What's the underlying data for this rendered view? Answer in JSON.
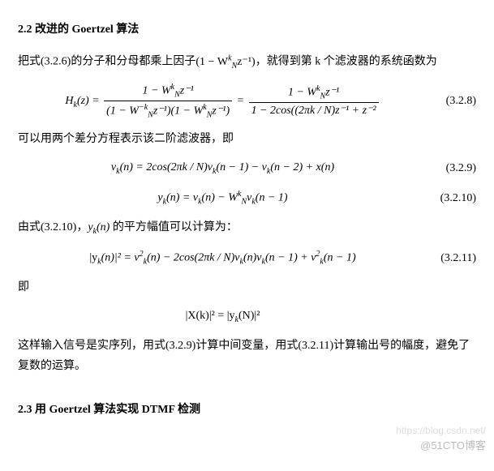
{
  "section22": {
    "heading": "2.2 改进的 Goertzel  算法",
    "p1_a": "把式(3.2.6)的分子和分母都乘上因子",
    "p1_factor": "(1 − W",
    "p1_factor_sub": "N",
    "p1_factor_sup": "k",
    "p1_factor_end": "z⁻¹)",
    "p1_b": "，就得到第 k 个滤波器的系统函数为",
    "eq328": {
      "lhs": "H",
      "lhs_sub": "k",
      "lhs_arg": "(z) = ",
      "num1": "1 − W",
      "num1_sub": "N",
      "num1_sup": "k",
      "num1_end": "z⁻¹",
      "den1a": "(1 − W",
      "den1a_sub": "N",
      "den1a_sup": "−k",
      "den1a_end": "z⁻¹)(1 − W",
      "den1b_sub": "N",
      "den1b_sup": "k",
      "den1b_end": "z⁻¹)",
      "eq": " = ",
      "num2": "1 − W",
      "num2_sub": "N",
      "num2_sup": "k",
      "num2_end": "z⁻¹",
      "den2": "1 − 2cos((2πk / N)z⁻¹ + z⁻²",
      "num": "(3.2.8)"
    },
    "p2": "可以用两个差分方程表示该二阶滤波器，即",
    "eq329": {
      "text": "v",
      "sub1": "k",
      "body": "(n) = 2cos(2πk / N)v",
      "sub2": "k",
      "body2": "(n − 1) − v",
      "sub3": "k",
      "body3": "(n − 2) + x(n)",
      "num": "(3.2.9)"
    },
    "eq3210": {
      "text": "y",
      "sub1": "k",
      "body": "(n) = v",
      "sub2": "k",
      "body2": "(n) − W",
      "supN": "k",
      "subN": "N",
      "body3": "v",
      "sub3": "k",
      "body4": "(n − 1)",
      "num": "(3.2.10)"
    },
    "p3a": "由式(3.2.10)，",
    "p3y": "y",
    "p3y_sub": "k",
    "p3y_arg": "(n)",
    "p3b": " 的平方幅值可以计算为：",
    "eq3211": {
      "lhs": "|y",
      "lhs_sub": "k",
      "lhs2": "(n)|² = v",
      "sub1": "k",
      "sup1": "2",
      "body1": "(n) − 2cos(2πk / N)v",
      "sub2": "k",
      "body2": "(n)v",
      "sub3": "k",
      "body3": "(n − 1) + v",
      "sub4": "k",
      "sup4": "2",
      "body4": "(n − 1)",
      "num": "(3.2.11)"
    },
    "p4": "即",
    "eq_final": {
      "text": "|X(k)|² = |y",
      "sub": "k",
      "end": "(N)|²"
    },
    "p5": "这样输入信号是实序列，用式(3.2.9)计算中间变量，用式(3.2.11)计算输出号的幅度，避免了复数的运算。"
  },
  "section23": {
    "heading": "2.3 用 Goertzel  算法实现 DTMF 检测"
  },
  "watermark": {
    "line1": "https://blog.csdn.net/",
    "line2": "@51CTO博客"
  }
}
